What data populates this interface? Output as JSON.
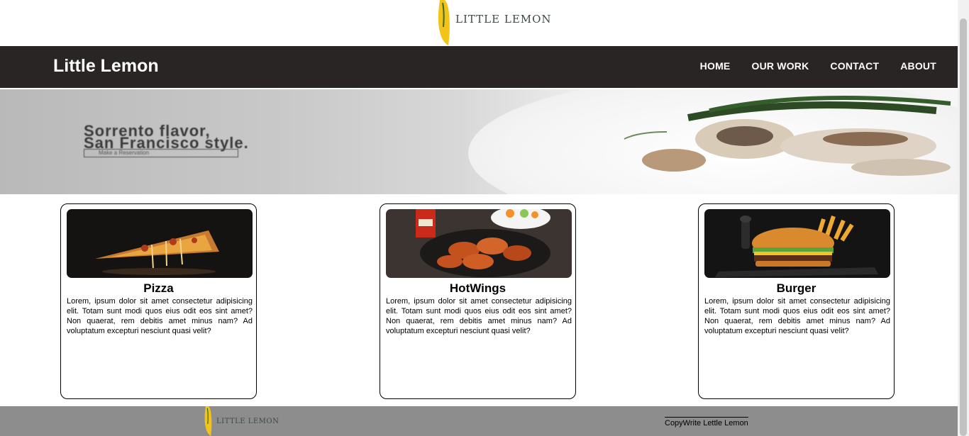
{
  "top_logo": {
    "text": "LITTLE LEMON",
    "icon": "lemon-icon"
  },
  "navbar": {
    "brand": "Little Lemon",
    "links": [
      "HOME",
      "OUR WORK",
      "CONTACT",
      "ABOUT"
    ]
  },
  "hero": {
    "headline_line1": "Sorrento flavor,",
    "headline_line2": "San Francisco style.",
    "button": "Make a Reservation"
  },
  "cards": [
    {
      "title": "Pizza",
      "text": "Lorem, ipsum dolor sit amet consectetur adipisicing elit. Totam sunt modi quos eius odit eos sint amet? Non quaerat, rem debitis amet minus nam? Ad voluptatum excepturi nesciunt quasi velit?"
    },
    {
      "title": "HotWings",
      "text": "Lorem, ipsum dolor sit amet consectetur adipisicing elit. Totam sunt modi quos eius odit eos sint amet? Non quaerat, rem debitis amet minus nam? Ad voluptatum excepturi nesciunt quasi velit?"
    },
    {
      "title": "Burger",
      "text": "Lorem, ipsum dolor sit amet consectetur adipisicing elit. Totam sunt modi quos eius odit eos sint amet? Non quaerat, rem debitis amet minus nam? Ad voluptatum excepturi nesciunt quasi velit?"
    }
  ],
  "footer": {
    "logo_text": "LITTLE LEMON",
    "copyright": "CopyWrite Lettle Lemon"
  },
  "colors": {
    "navbar_bg": "#2a2525",
    "footer_bg": "#8d8d8d",
    "lemon": "#f2c418"
  }
}
